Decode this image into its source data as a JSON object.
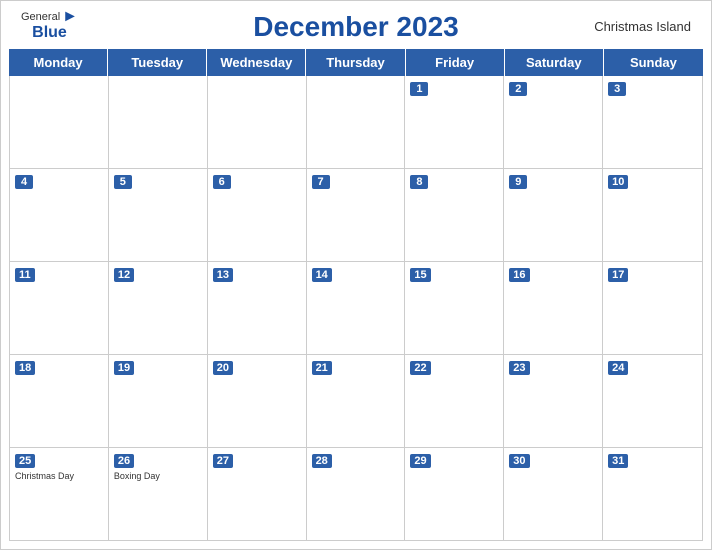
{
  "header": {
    "logo_general": "General",
    "logo_blue": "Blue",
    "title": "December 2023",
    "subtitle": "Christmas Island"
  },
  "day_headers": [
    "Monday",
    "Tuesday",
    "Wednesday",
    "Thursday",
    "Friday",
    "Saturday",
    "Sunday"
  ],
  "weeks": [
    [
      {
        "day": "",
        "holiday": ""
      },
      {
        "day": "",
        "holiday": ""
      },
      {
        "day": "",
        "holiday": ""
      },
      {
        "day": "",
        "holiday": ""
      },
      {
        "day": "1",
        "holiday": ""
      },
      {
        "day": "2",
        "holiday": ""
      },
      {
        "day": "3",
        "holiday": ""
      }
    ],
    [
      {
        "day": "4",
        "holiday": ""
      },
      {
        "day": "5",
        "holiday": ""
      },
      {
        "day": "6",
        "holiday": ""
      },
      {
        "day": "7",
        "holiday": ""
      },
      {
        "day": "8",
        "holiday": ""
      },
      {
        "day": "9",
        "holiday": ""
      },
      {
        "day": "10",
        "holiday": ""
      }
    ],
    [
      {
        "day": "11",
        "holiday": ""
      },
      {
        "day": "12",
        "holiday": ""
      },
      {
        "day": "13",
        "holiday": ""
      },
      {
        "day": "14",
        "holiday": ""
      },
      {
        "day": "15",
        "holiday": ""
      },
      {
        "day": "16",
        "holiday": ""
      },
      {
        "day": "17",
        "holiday": ""
      }
    ],
    [
      {
        "day": "18",
        "holiday": ""
      },
      {
        "day": "19",
        "holiday": ""
      },
      {
        "day": "20",
        "holiday": ""
      },
      {
        "day": "21",
        "holiday": ""
      },
      {
        "day": "22",
        "holiday": ""
      },
      {
        "day": "23",
        "holiday": ""
      },
      {
        "day": "24",
        "holiday": ""
      }
    ],
    [
      {
        "day": "25",
        "holiday": "Christmas Day"
      },
      {
        "day": "26",
        "holiday": "Boxing Day"
      },
      {
        "day": "27",
        "holiday": ""
      },
      {
        "day": "28",
        "holiday": ""
      },
      {
        "day": "29",
        "holiday": ""
      },
      {
        "day": "30",
        "holiday": ""
      },
      {
        "day": "31",
        "holiday": ""
      }
    ]
  ]
}
